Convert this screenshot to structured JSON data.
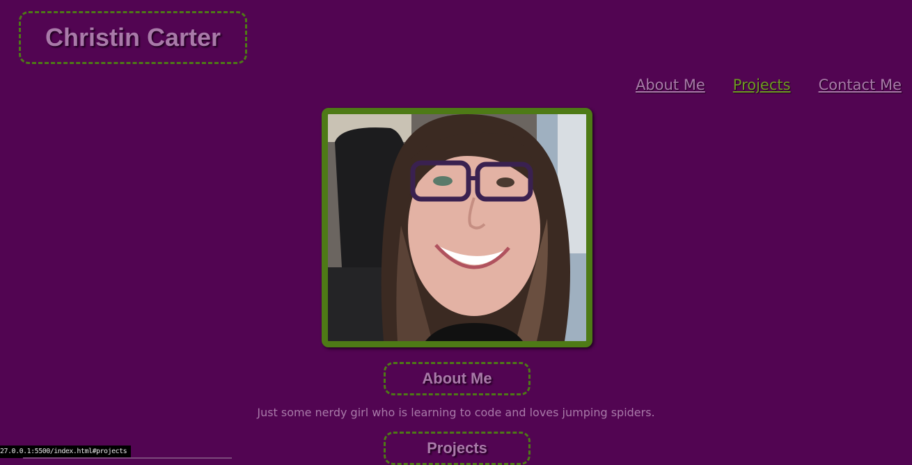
{
  "header": {
    "site_title": "Christin Carter"
  },
  "nav": {
    "items": [
      {
        "label": "About Me",
        "active": false
      },
      {
        "label": "Projects",
        "active": true
      },
      {
        "label": "Contact Me",
        "active": false
      }
    ]
  },
  "profile": {
    "photo_alt": "Christin Carter selfie"
  },
  "about": {
    "heading": "About Me",
    "text": "Just some nerdy girl who is learning to code and loves jumping spiders."
  },
  "projects": {
    "heading": "Projects"
  },
  "status_bar": {
    "url": "27.0.0.1:5500/index.html#projects"
  },
  "colors": {
    "background": "#520552",
    "accent_green": "#4e7a16",
    "text": "#a97aa9",
    "active_link": "#6f9a22"
  }
}
